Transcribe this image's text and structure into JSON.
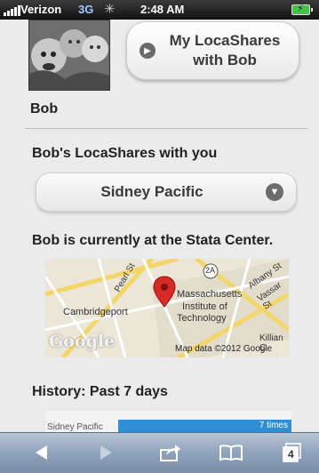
{
  "status_bar": {
    "carrier": "Verizon",
    "network": "3G",
    "time": "2:48 AM",
    "battery_icon": "battery-charging-icon"
  },
  "profile": {
    "name": "Bob",
    "avatar_icon": "avatar-photo"
  },
  "header_button": {
    "label_line1": "My LocaShares",
    "label_line2": "with Bob",
    "icon": "chevron-right-icon"
  },
  "locashares": {
    "heading": "Bob's LocaShares with you",
    "selected": "Sidney Pacific",
    "icon": "chevron-down-icon"
  },
  "location": {
    "status_text": "Bob is currently at the Stata Center.",
    "map": {
      "labels": [
        "Cambridgeport",
        "Massachusetts",
        "Institute of",
        "Technology",
        "Pearl St",
        "Albany St",
        "Vassar St",
        "Killian C"
      ],
      "route_badge": "2A",
      "attribution": "Map data ©2012 Google",
      "logo": "Google"
    }
  },
  "history": {
    "heading": "History: Past 7 days",
    "chart_data": {
      "type": "bar",
      "categories": [
        "Sidney Pacific"
      ],
      "values": [
        7
      ],
      "value_labels": [
        "7 times"
      ]
    }
  },
  "toolbar": {
    "items": [
      "back-icon",
      "forward-icon",
      "share-icon",
      "bookmarks-icon",
      "tabs-icon"
    ],
    "tabs_count": "4"
  },
  "colors": {
    "toolbar": "#8fa2bb",
    "bar": "#2f8fd6",
    "pin": "#d92b25"
  }
}
